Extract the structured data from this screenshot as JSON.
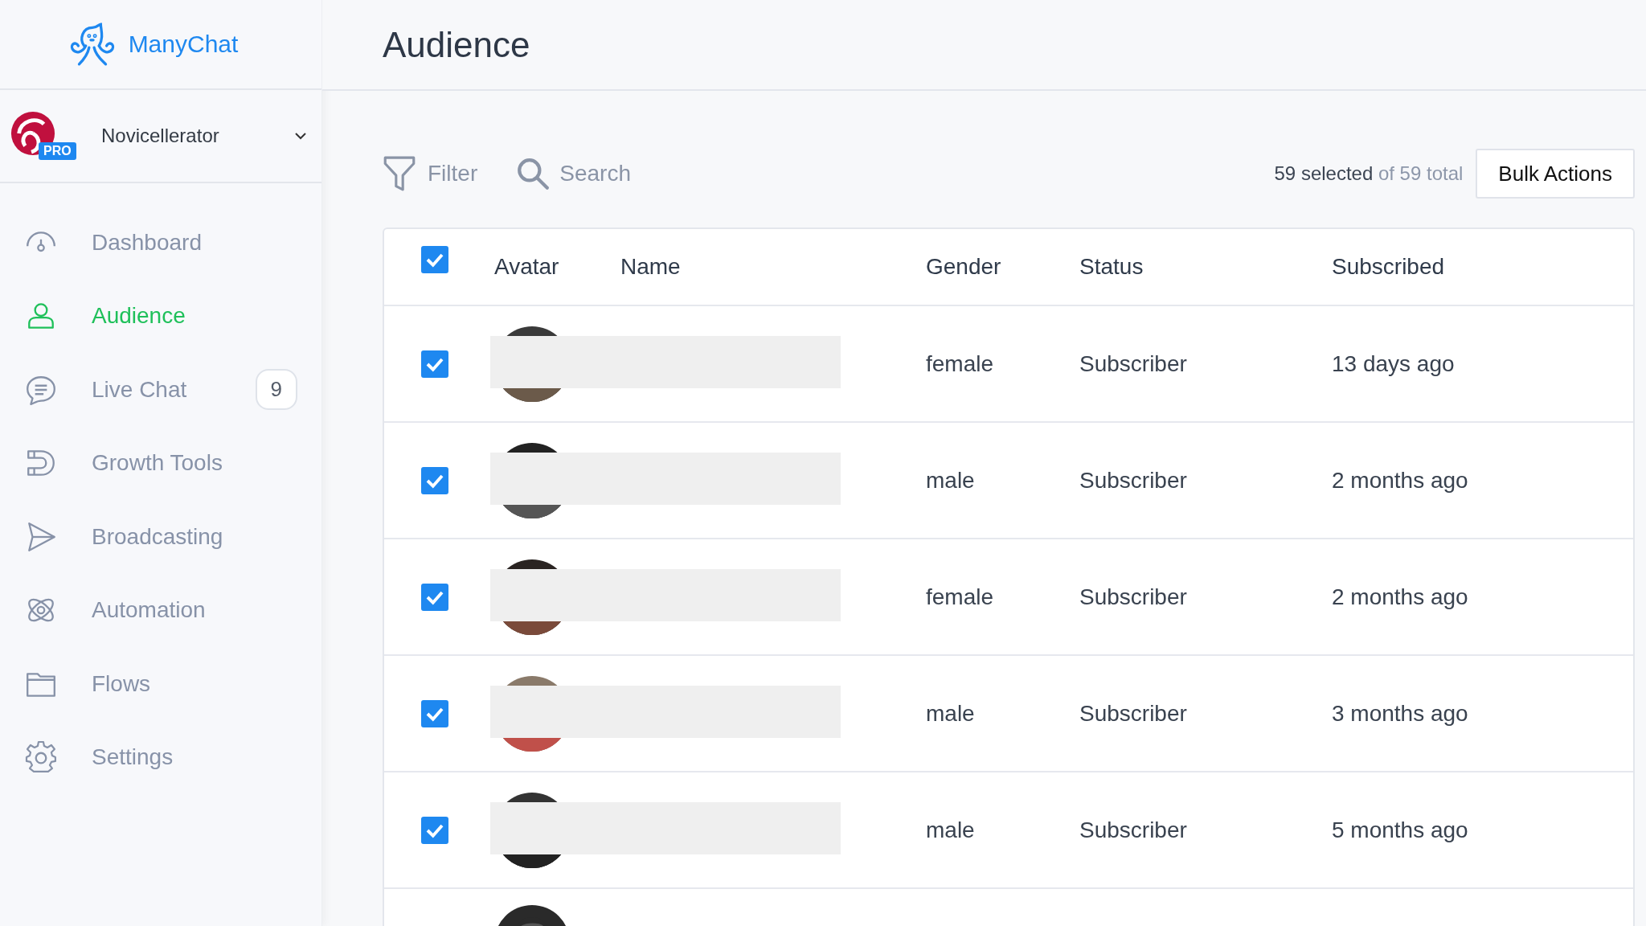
{
  "brand": {
    "name": "ManyChat"
  },
  "account": {
    "name": "Novicellerator",
    "badge": "PRO"
  },
  "sidebar": {
    "items": [
      {
        "kind": "dashboard",
        "label": "Dashboard",
        "selected": false
      },
      {
        "kind": "audience",
        "label": "Audience",
        "selected": true
      },
      {
        "kind": "chat",
        "label": "Live Chat",
        "selected": false,
        "count": "9"
      },
      {
        "kind": "growth",
        "label": "Growth Tools",
        "selected": false
      },
      {
        "kind": "broadcast",
        "label": "Broadcasting",
        "selected": false
      },
      {
        "kind": "automation",
        "label": "Automation",
        "selected": false
      },
      {
        "kind": "flows",
        "label": "Flows",
        "selected": false
      },
      {
        "kind": "settings",
        "label": "Settings",
        "selected": false
      }
    ]
  },
  "page": {
    "title": "Audience"
  },
  "toolbar": {
    "filter": "Filter",
    "search_placeholder": "Search",
    "selected_count": "59 selected",
    "total": "of 59 total",
    "bulk_button": "Bulk Actions"
  },
  "table": {
    "select_all": {
      "checked": true
    },
    "columns": [
      "Avatar",
      "Name",
      "Gender",
      "Status",
      "Subscribed"
    ],
    "rows": [
      {
        "checked": true,
        "avatar": {
          "kind": "picture"
        },
        "name_redacted": true,
        "gender": "female",
        "status": "Subscriber",
        "subscribed": "13 days ago"
      },
      {
        "checked": true,
        "avatar": {
          "kind": "picture"
        },
        "name_redacted": true,
        "gender": "male",
        "status": "Subscriber",
        "subscribed": "2 months ago"
      },
      {
        "checked": true,
        "avatar": {
          "kind": "picture"
        },
        "name_redacted": true,
        "gender": "female",
        "status": "Subscriber",
        "subscribed": "2 months ago"
      },
      {
        "checked": true,
        "avatar": {
          "kind": "picture"
        },
        "name_redacted": true,
        "gender": "male",
        "status": "Subscriber",
        "subscribed": "3 months ago"
      },
      {
        "checked": true,
        "avatar": {
          "kind": "picture"
        },
        "name_redacted": true,
        "gender": "male",
        "status": "Subscriber",
        "subscribed": "5 months ago"
      },
      {
        "avatar": {
          "kind": "picture"
        }
      }
    ]
  }
}
